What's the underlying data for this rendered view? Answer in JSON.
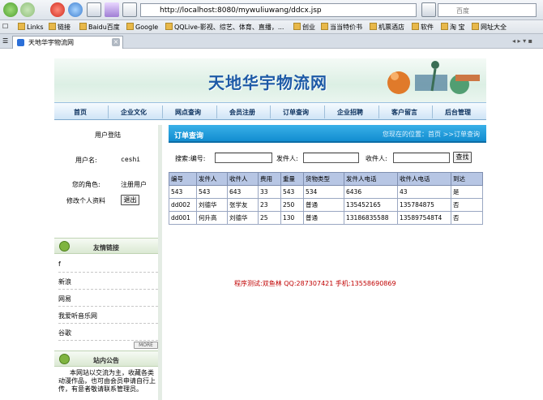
{
  "browser": {
    "url": "http://localhost:8080/mywuliuwang/ddcx.jsp",
    "search_placeholder": "百度",
    "tab_title": "天地华宇物流网",
    "bookmarks": [
      "Links",
      "链接",
      "Baidu百度",
      "Google",
      "QQLive-影视、综艺、体育、直播，...",
      "创业",
      "当当特价书",
      "机票酒店",
      "软件",
      "淘 宝",
      "网址大全"
    ]
  },
  "site": {
    "title": "天地华宇物流网",
    "nav": [
      "首页",
      "企业文化",
      "网点查询",
      "会员注册",
      "订单查询",
      "企业招聘",
      "客户留言",
      "后台管理"
    ]
  },
  "login": {
    "heading": "用户登陆",
    "username_label": "用户名:",
    "username_value": "ceshi",
    "role_label": "您的角色:",
    "role_value": "注册用户",
    "edit_profile": "修改个人资料",
    "logout": "退出"
  },
  "friend_links": {
    "heading": "友情链接",
    "items": [
      "f",
      "新浪",
      "网易",
      "我爱听音乐网",
      "谷歌"
    ],
    "more": "MORE"
  },
  "announcement": {
    "heading": "站内公告",
    "text": "本网站以交流为主，收藏各类动漫作品，也可由会员申请自行上传，有意者敬请联系管理员。"
  },
  "order_query": {
    "title": "订单查询",
    "breadcrumb": "您现在的位置：首页 >>订单查询",
    "search_label": "搜索:编号:",
    "sender_label": "发件人:",
    "receiver_label": "收件人:",
    "search_button": "查找",
    "columns": [
      "编号",
      "发件人",
      "收件人",
      "费用",
      "重量",
      "货物类型",
      "发件人电话",
      "收件人电话",
      "到达"
    ],
    "rows": [
      [
        "543",
        "543",
        "643",
        "33",
        "543",
        "534",
        "6436",
        "43",
        "是"
      ],
      [
        "dd002",
        "刘德华",
        "张学友",
        "23",
        "250",
        "普通",
        "135452165",
        "135784875",
        "否"
      ],
      [
        "dd001",
        "何升高",
        "刘德华",
        "25",
        "130",
        "普通",
        "13186835588",
        "135897548T4",
        "否"
      ]
    ]
  },
  "footer_note": "程序测试:双鱼林 QQ:287307421 手机:13558690869"
}
